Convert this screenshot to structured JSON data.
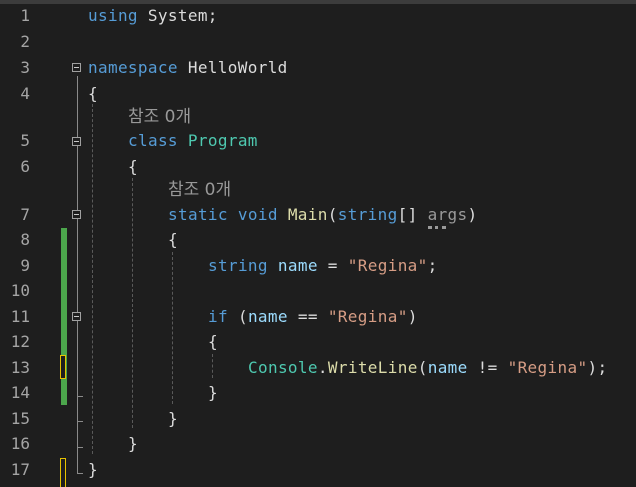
{
  "lines": [
    {
      "number": "1"
    },
    {
      "number": "2"
    },
    {
      "number": "3"
    },
    {
      "number": "4"
    },
    {
      "number": "5"
    },
    {
      "number": "6"
    },
    {
      "number": "7"
    },
    {
      "number": "8"
    },
    {
      "number": "9"
    },
    {
      "number": "10"
    },
    {
      "number": "11"
    },
    {
      "number": "12"
    },
    {
      "number": "13"
    },
    {
      "number": "14"
    },
    {
      "number": "15"
    },
    {
      "number": "16"
    },
    {
      "number": "17"
    }
  ],
  "codelens": {
    "program_refs": "참조 0개",
    "main_refs": "참조 0개"
  },
  "code": {
    "l1_kw": "using",
    "l1_ns": " System;",
    "l3_kw": "namespace",
    "l3_name": " HelloWorld",
    "brace_open": "{",
    "brace_close": "}",
    "l5_kw": "class",
    "l5_type": "Program",
    "l7_static": "static",
    "l7_void": "void",
    "l7_main": "Main",
    "l7_paren_open": "(",
    "l7_string": "string",
    "l7_brackets": "[] ",
    "l7_args": "args",
    "l7_paren_close": ")",
    "l9_type": "string",
    "l9_var": "name",
    "l9_eq": " = ",
    "l9_str": "\"Regina\"",
    "l9_semi": ";",
    "l11_if": "if",
    "l11_open": " (",
    "l11_var": "name",
    "l11_op": " == ",
    "l11_str": "\"Regina\"",
    "l11_close": ")",
    "l13_console": "Console",
    "l13_dot": ".",
    "l13_method": "WriteLine",
    "l13_open": "(",
    "l13_var": "name",
    "l13_op": " != ",
    "l13_str": "\"Regina\"",
    "l13_close": ");"
  },
  "colors": {
    "background": "#1e1e1e",
    "keyword": "#569cd6",
    "type": "#4ec9b0",
    "string": "#d69d85",
    "variable": "#9cdcfe",
    "method": "#dcdcaa",
    "line_number": "#a5a5a5",
    "saved_change": "#4ca64c",
    "unsaved_change": "#e5c100"
  },
  "icons": {
    "fold": "collapse-minus-icon"
  }
}
